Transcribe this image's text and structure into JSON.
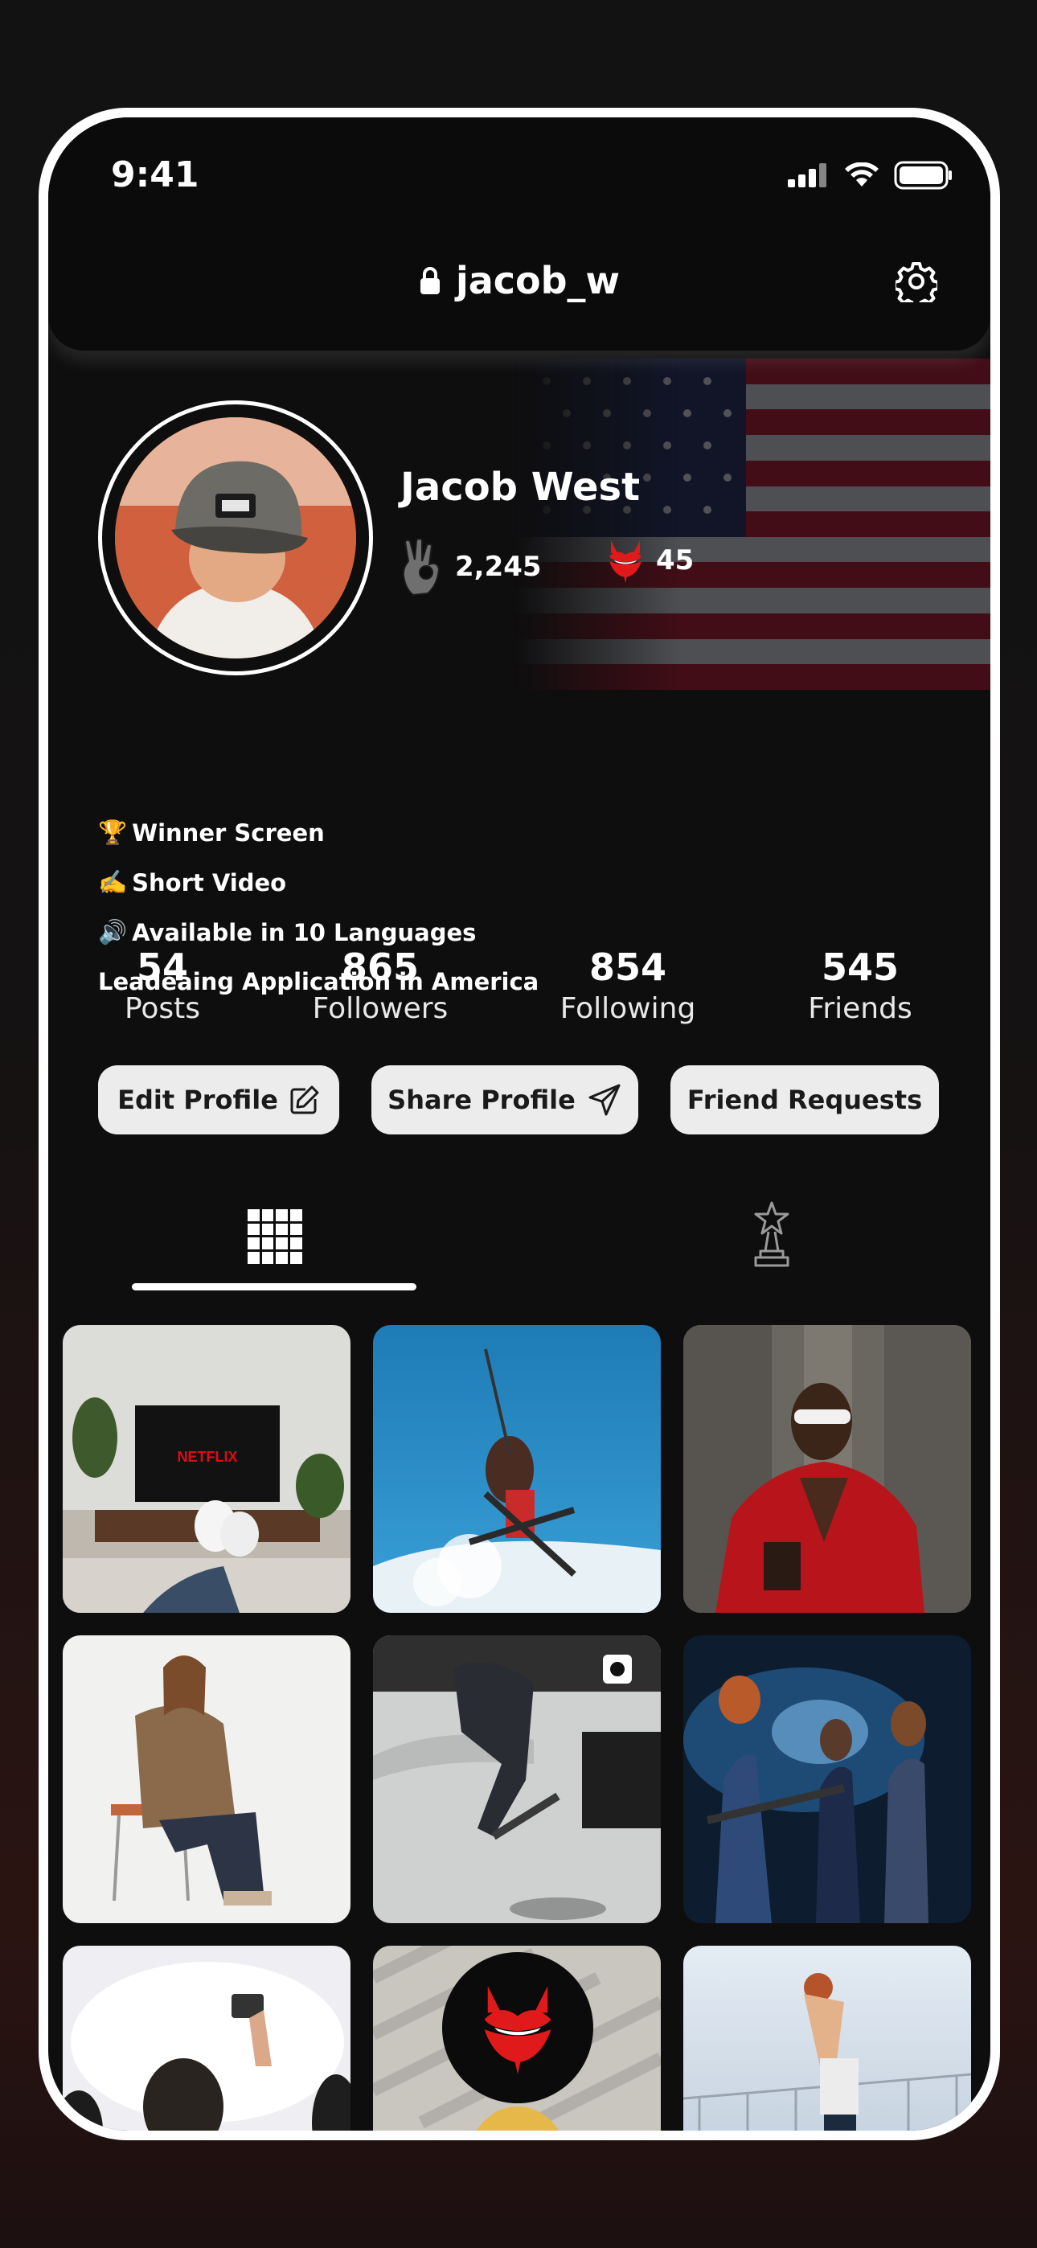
{
  "status_bar": {
    "time": "9:41"
  },
  "header": {
    "username": "jacob_w"
  },
  "profile": {
    "name": "Jacob West",
    "hand_count": "2,245",
    "devil_count": "45",
    "bio": [
      {
        "emoji": "🏆",
        "text": "Winner Screen"
      },
      {
        "emoji": "✍️",
        "text": "Short Video"
      },
      {
        "emoji": "🔊",
        "text": "Available in 10 Languages"
      },
      {
        "emoji": "",
        "text": "Leadeaing Application in America"
      }
    ]
  },
  "stats": [
    {
      "value": "54",
      "label": "Posts"
    },
    {
      "value": "865",
      "label": "Followers"
    },
    {
      "value": "854",
      "label": "Following"
    },
    {
      "value": "545",
      "label": "Friends"
    }
  ],
  "buttons": {
    "edit": "Edit Profile",
    "share": "Share Profile",
    "requests": "Friend Requests"
  },
  "tabs": {
    "active": "grid"
  },
  "grid": [
    {
      "name": "tv-room-photo",
      "tv_label": "NETFLIX"
    },
    {
      "name": "skier-photo"
    },
    {
      "name": "red-jacket-photo"
    },
    {
      "name": "sitting-woman-photo"
    },
    {
      "name": "skater-photo"
    },
    {
      "name": "band-concert-photo"
    },
    {
      "name": "crowd-photo"
    },
    {
      "name": "yellow-photo"
    },
    {
      "name": "basketball-photo"
    }
  ],
  "colors": {
    "accent": "#d41c1c",
    "background": "#0e0e0f",
    "button": "#ececec"
  }
}
